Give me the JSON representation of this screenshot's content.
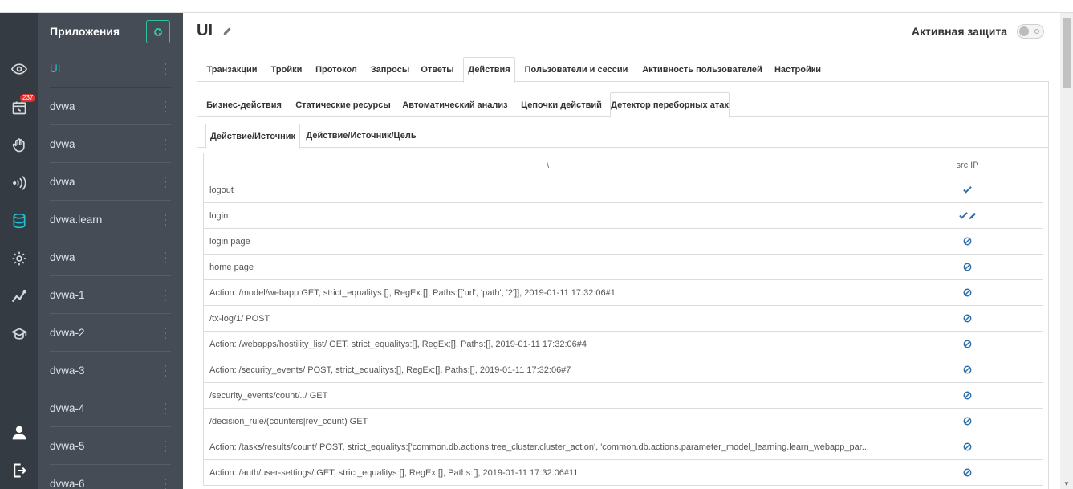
{
  "sidebar": {
    "badge": "237",
    "icons": [
      "eye-icon",
      "calendar-icon",
      "hand-icon",
      "signal-icon",
      "database-icon",
      "gear-icon",
      "chart-icon",
      "graduation-icon",
      "user-icon",
      "logout-icon"
    ]
  },
  "apps": {
    "title": "Приложения",
    "items": [
      {
        "label": "UI",
        "active": true
      },
      {
        "label": "dvwa"
      },
      {
        "label": "dvwa"
      },
      {
        "label": "dvwa"
      },
      {
        "label": "dvwa.learn"
      },
      {
        "label": "dvwa"
      },
      {
        "label": "dvwa-1"
      },
      {
        "label": "dvwa-2"
      },
      {
        "label": "dvwa-3"
      },
      {
        "label": "dvwa-4"
      },
      {
        "label": "dvwa-5"
      },
      {
        "label": "dvwa-6"
      }
    ]
  },
  "header": {
    "title": "UI",
    "protection_label": "Активная защита"
  },
  "tabs_main": [
    {
      "label": "Транзакции"
    },
    {
      "label": "Тройки"
    },
    {
      "label": "Протокол"
    },
    {
      "label": "Запросы"
    },
    {
      "label": "Ответы"
    },
    {
      "label": "Действия",
      "active": true
    },
    {
      "label": "Пользователи и сессии"
    },
    {
      "label": "Активность пользователей"
    },
    {
      "label": "Настройки"
    }
  ],
  "tabs_sub": [
    {
      "label": "Бизнес-действия"
    },
    {
      "label": "Статические ресурсы"
    },
    {
      "label": "Автоматический анализ"
    },
    {
      "label": "Цепочки действий"
    },
    {
      "label": "Детектор переборных атак",
      "active": true
    }
  ],
  "tabs_sub2": [
    {
      "label": "Действие/Источник",
      "active": true
    },
    {
      "label": "Действие/Источник/Цель"
    }
  ],
  "table": {
    "headers": [
      "\\",
      "src IP"
    ],
    "rows": [
      {
        "action": "logout",
        "status": "check"
      },
      {
        "action": "login",
        "status": "check-edit"
      },
      {
        "action": "login page",
        "status": "blocked"
      },
      {
        "action": "home page",
        "status": "blocked"
      },
      {
        "action": "Action: /model/webapp GET, strict_equalitys:[], RegEx:[], Paths:[['url', 'path', '2']], 2019-01-11 17:32:06#1",
        "status": "blocked"
      },
      {
        "action": "/tx-log/1/ POST",
        "status": "blocked"
      },
      {
        "action": "Action: /webapps/hostility_list/ GET, strict_equalitys:[], RegEx:[], Paths:[], 2019-01-11 17:32:06#4",
        "status": "blocked"
      },
      {
        "action": "Action: /security_events/ POST, strict_equalitys:[], RegEx:[], Paths:[], 2019-01-11 17:32:06#7",
        "status": "blocked"
      },
      {
        "action": "/security_events/count/../ GET",
        "status": "blocked"
      },
      {
        "action": "/decision_rule/(counters|rev_count) GET",
        "status": "blocked"
      },
      {
        "action": "Action: /tasks/results/count/ POST, strict_equalitys:['common.db.actions.tree_cluster.cluster_action', 'common.db.actions.parameter_model_learning.learn_webapp_par...",
        "status": "blocked"
      },
      {
        "action": "Action: /auth/user-settings/ GET, strict_equalitys:[], RegEx:[], Paths:[], 2019-01-11 17:32:06#11",
        "status": "blocked"
      }
    ]
  },
  "colors": {
    "rail": "#353b43",
    "apps_panel": "#454c56",
    "accent": "#21c3d3",
    "add_button": "#2ec4a0",
    "check": "#2f6fa8",
    "badge": "#e0322e"
  }
}
